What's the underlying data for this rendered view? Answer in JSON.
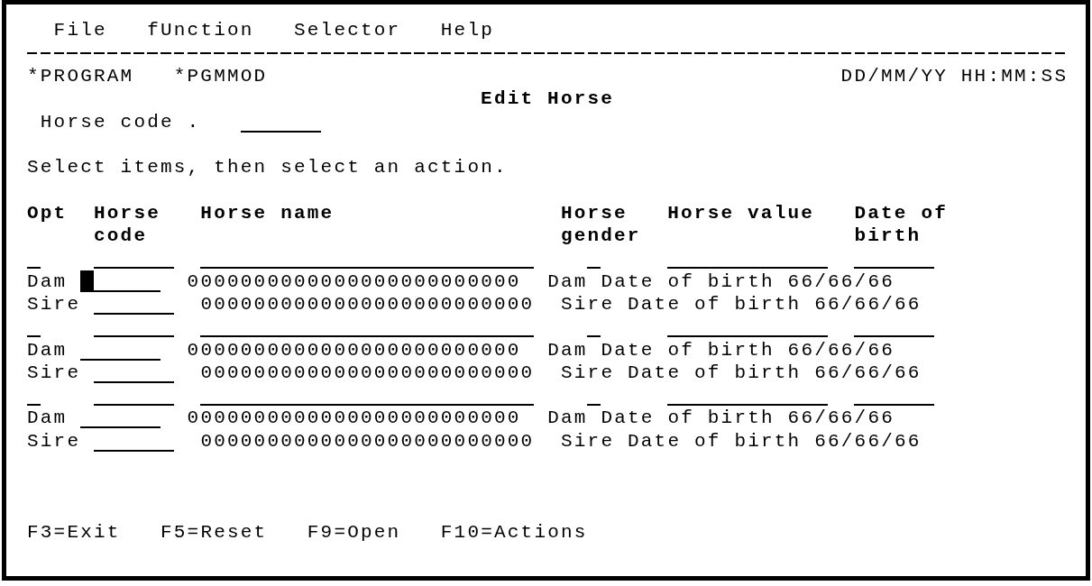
{
  "menu_bar": [
    "File",
    "fUnction",
    "Selector",
    "Help"
  ],
  "header": {
    "program": "*PROGRAM",
    "module": "*PGMMOD",
    "date_time": "DD/MM/YY HH:MM:SS",
    "title": "Edit Horse"
  },
  "position_to": {
    "label": "Horse code ."
  },
  "instruction": "Select items, then select an action.",
  "columns": [
    "Opt",
    "Horse code",
    "Horse name",
    "Horse gender",
    "Horse value",
    "Date of birth"
  ],
  "records": [
    {
      "parents": [
        {
          "label": "Dam",
          "has_cursor": true,
          "name": "0000000000000000000000000",
          "birth_date": "Dam Date of birth 66/66/66"
        },
        {
          "label": "Sire",
          "has_cursor": false,
          "name": "0000000000000000000000000",
          "birth_date": "Sire Date of birth 66/66/66"
        }
      ]
    },
    {
      "parents": [
        {
          "label": "Dam",
          "has_cursor": false,
          "name": "0000000000000000000000000",
          "birth_date": "Dam Date of birth 66/66/66"
        },
        {
          "label": "Sire",
          "has_cursor": false,
          "name": "0000000000000000000000000",
          "birth_date": "Sire Date of birth 66/66/66"
        }
      ]
    },
    {
      "parents": [
        {
          "label": "Dam",
          "has_cursor": false,
          "name": "0000000000000000000000000",
          "birth_date": "Dam Date of birth 66/66/66"
        },
        {
          "label": "Sire",
          "has_cursor": false,
          "name": "0000000000000000000000000",
          "birth_date": "Sire Date of birth 66/66/66"
        }
      ]
    }
  ],
  "function_keys": [
    "F3=Exit",
    "F5=Reset",
    "F9=Open",
    "F10=Actions"
  ]
}
